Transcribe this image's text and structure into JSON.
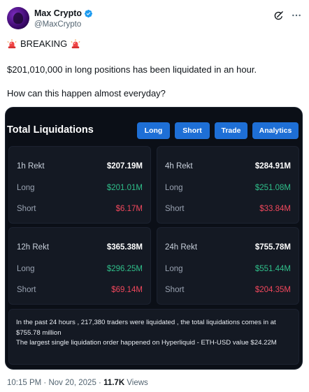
{
  "author": {
    "name": "Max Crypto",
    "handle": "@MaxCrypto"
  },
  "tweet": {
    "breaking": "BREAKING",
    "line1": "$201,010,000 in long positions has been liquidated in an hour.",
    "line2": "How can this happen almost everyday?"
  },
  "card": {
    "title": "Total Liquidations",
    "tabs": [
      "Long",
      "Short",
      "Trade",
      "Analytics"
    ],
    "panels": [
      {
        "period": "1h Rekt",
        "total": "$207.19M",
        "long_label": "Long",
        "long": "$201.01M",
        "short_label": "Short",
        "short": "$6.17M"
      },
      {
        "period": "4h Rekt",
        "total": "$284.91M",
        "long_label": "Long",
        "long": "$251.08M",
        "short_label": "Short",
        "short": "$33.84M"
      },
      {
        "period": "12h Rekt",
        "total": "$365.38M",
        "long_label": "Long",
        "long": "$296.25M",
        "short_label": "Short",
        "short": "$69.14M"
      },
      {
        "period": "24h Rekt",
        "total": "$755.78M",
        "long_label": "Long",
        "long": "$551.44M",
        "short_label": "Short",
        "short": "$204.35M"
      }
    ],
    "summary_1": "In the past 24 hours , 217,380 traders were liquidated , the total liquidations comes in at $755.78 million",
    "summary_2": "The largest single liquidation order happened on Hyperliquid - ETH-USD value $24.22M"
  },
  "meta": {
    "time": "10:15 PM · Nov 20, 2025 · ",
    "views": "11.7K",
    "views_label": " Views"
  },
  "colors": {
    "long": "#2fbf8a",
    "short": "#f0475c",
    "tab": "#1e6fd6",
    "verified": "#1d9bf0"
  },
  "icons": [
    "verified-badge-icon",
    "grok-icon",
    "more-icon",
    "siren-icon"
  ]
}
